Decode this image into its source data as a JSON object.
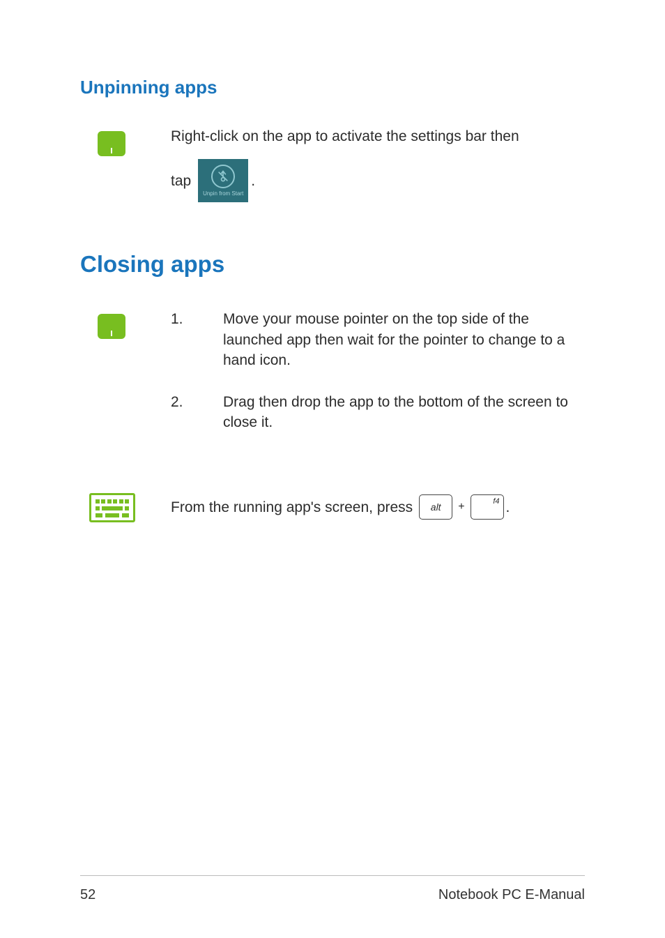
{
  "headings": {
    "unpinning": "Unpinning apps",
    "closing": "Closing apps"
  },
  "unpin": {
    "line1": "Right-click on the app to activate the settings bar then",
    "tap_word": "tap",
    "tile_label": "Unpin from Start",
    "period": "."
  },
  "closing_steps": {
    "s1_num": "1.",
    "s1_text": "Move your mouse pointer on the top side of the launched app then wait for the pointer to change to a hand icon.",
    "s2_num": "2.",
    "s2_text": "Drag then drop the app to the bottom of the screen to close it."
  },
  "keyboard": {
    "prefix": "From the running app's screen, press",
    "key1": "alt",
    "plus": "+",
    "key2": "f4",
    "period": "."
  },
  "footer": {
    "page_number": "52",
    "doc_title": "Notebook PC E-Manual"
  }
}
